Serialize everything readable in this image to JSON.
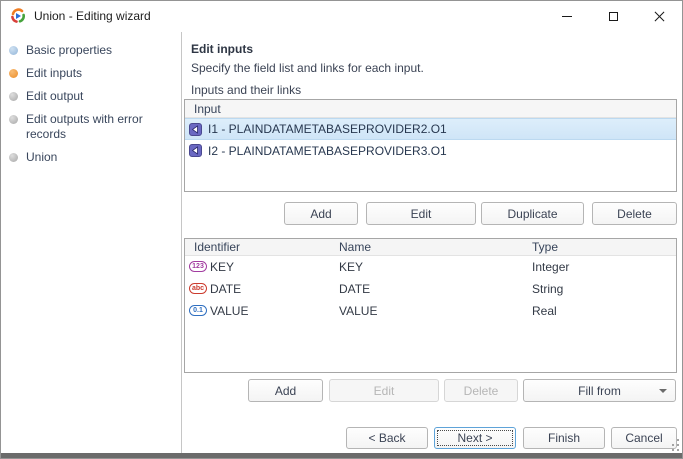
{
  "window": {
    "title": "Union - Editing wizard"
  },
  "sidebar": {
    "items": [
      {
        "label": "Basic properties",
        "state": "done"
      },
      {
        "label": "Edit inputs",
        "state": "current"
      },
      {
        "label": "Edit output",
        "state": "todo"
      },
      {
        "label": "Edit outputs with error records",
        "state": "todo"
      },
      {
        "label": "Union",
        "state": "todo"
      }
    ]
  },
  "main": {
    "heading": "Edit inputs",
    "description": "Specify the field list and links for each input.",
    "inputs_label": "Inputs and their links",
    "inputs_list": {
      "header": "Input",
      "items": [
        {
          "label": "I1 - PLAINDATAMETABASEPROVIDER2.O1",
          "selected": true
        },
        {
          "label": "I2 - PLAINDATAMETABASEPROVIDER3.O1",
          "selected": false
        }
      ]
    },
    "input_buttons": {
      "add": "Add",
      "edit": "Edit",
      "duplicate": "Duplicate",
      "delete": "Delete"
    },
    "fields_table": {
      "columns": {
        "identifier": "Identifier",
        "name": "Name",
        "type": "Type"
      },
      "rows": [
        {
          "icon": "integer-field-icon",
          "icon_text": "123",
          "identifier": "KEY",
          "name": "KEY",
          "type": "Integer"
        },
        {
          "icon": "string-field-icon",
          "icon_text": "abc",
          "identifier": "DATE",
          "name": "DATE",
          "type": "String"
        },
        {
          "icon": "real-field-icon",
          "icon_text": "0.1",
          "identifier": "VALUE",
          "name": "VALUE",
          "type": "Real"
        }
      ]
    },
    "field_buttons": {
      "add": "Add",
      "edit": "Edit",
      "delete": "Delete",
      "fill_from": "Fill from"
    }
  },
  "footer": {
    "back": "< Back",
    "next": "Next >",
    "finish": "Finish",
    "cancel": "Cancel"
  },
  "colors": {
    "step_current": "#ec8d28",
    "step_done": "#92b5d8",
    "step_todo": "#a8a8a8",
    "selection_bg": "#d5e8f7",
    "port_icon": "#6a68c2",
    "integer_icon": "#a23ca0",
    "string_icon": "#cc3b2e",
    "real_icon": "#2f6fc0",
    "focus_border": "#5ea3d8",
    "window_edge": "#6b6b6b"
  }
}
